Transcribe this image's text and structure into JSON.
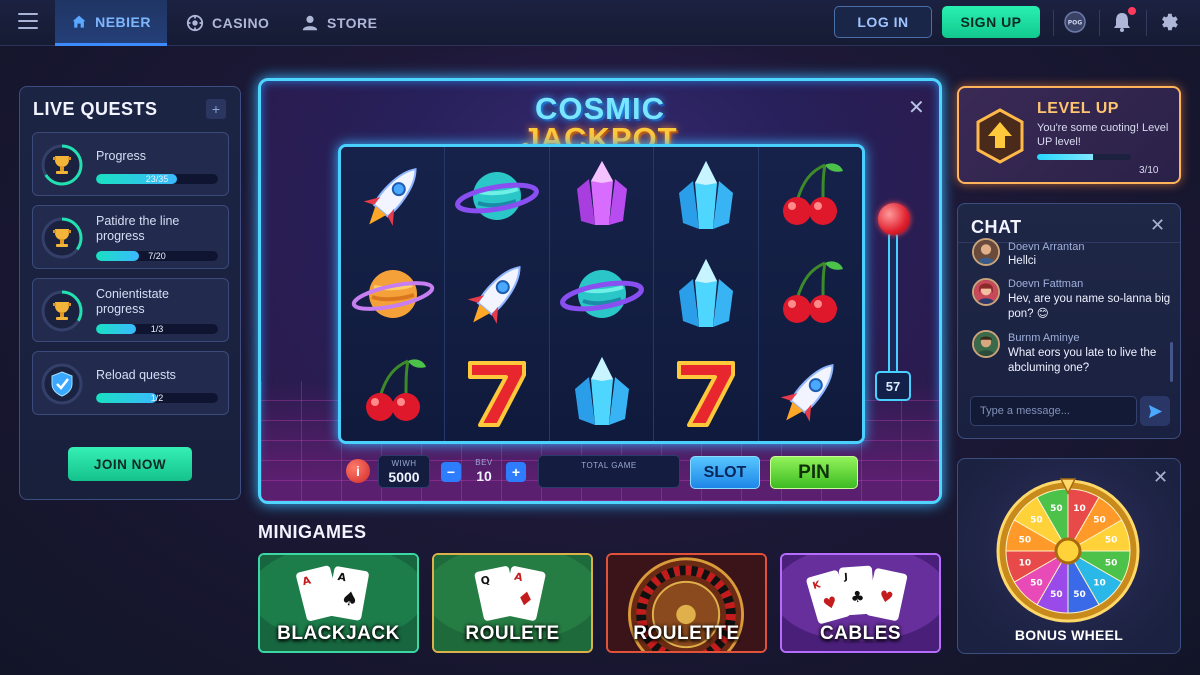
{
  "nav": {
    "tabs": [
      {
        "label": "NEBIER",
        "icon": "home-icon"
      },
      {
        "label": "CASINO",
        "icon": "chip-icon"
      },
      {
        "label": "STORE",
        "icon": "user-icon"
      }
    ],
    "login_label": "LOG IN",
    "signup_label": "SIGN UP",
    "badge_label": "POG",
    "right_icons": [
      "avatar-badge-icon",
      "bell-icon",
      "gear-icon"
    ]
  },
  "quests": {
    "title": "LIVE QUESTS",
    "add_label": "+",
    "items": [
      {
        "name": "Progress",
        "value": "23/35",
        "progress": 0.66
      },
      {
        "name": "Patidre the line progress",
        "value": "7/20",
        "progress": 0.35
      },
      {
        "name": "Conientistate progress",
        "value": "1/3",
        "progress": 0.33
      },
      {
        "name": "Reload quests",
        "value": "1/2",
        "progress": 0.5
      }
    ],
    "join_label": "JOIN NOW"
  },
  "slot": {
    "title_line1": "COSMIC",
    "title_line2": "JACKPOT",
    "reels": [
      [
        "rocket",
        "saturn",
        "cherry"
      ],
      [
        "planet",
        "rocket",
        "seven"
      ],
      [
        "gem-purple",
        "planet",
        "crystal-blue"
      ],
      [
        "crystal-blue",
        "crystal-blue",
        "seven"
      ],
      [
        "cherry",
        "cherry",
        "rocket"
      ]
    ],
    "lever_count": "57",
    "win_label": "WIWH",
    "win_value": "5000",
    "bet_label": "BEV",
    "bet_value": "10",
    "total_label": "TOTAL GAME",
    "total_value": "",
    "minus_label": "−",
    "plus_label": "+",
    "info_label": "i",
    "slot_button": "SLOT",
    "pin_button": "PIN",
    "colors": {
      "frame": "#4fd6ff",
      "gold": "#ffc93b"
    }
  },
  "minigames": {
    "title": "MINIGAMES",
    "cards": [
      {
        "label": "BLACKJACK",
        "theme": "green-felt"
      },
      {
        "label": "ROULETE",
        "theme": "green-felt-gold"
      },
      {
        "label": "ROULETTE",
        "theme": "wheel"
      },
      {
        "label": "CABLES",
        "theme": "purple"
      }
    ]
  },
  "levelup": {
    "title": "LEVEL UP",
    "desc": "You're some cuoting! Level UP level!",
    "value": "3/10",
    "progress": 0.6
  },
  "chat": {
    "title": "CHAT",
    "messages": [
      {
        "name": "Doevn Arrantan",
        "text": "Hellci"
      },
      {
        "name": "Doevn Fattman",
        "text": "Hev, are you name so-lanna big pon? 😊"
      },
      {
        "name": "Burnm Aminye",
        "text": "What eors you late to live the abcluming one?"
      }
    ],
    "input_placeholder": "Type a message..."
  },
  "bonus": {
    "label": "BONUS WHEEL",
    "segments": [
      "10",
      "50",
      "50",
      "50",
      "10",
      "50",
      "50",
      "50",
      "10",
      "50",
      "50",
      "50"
    ]
  }
}
